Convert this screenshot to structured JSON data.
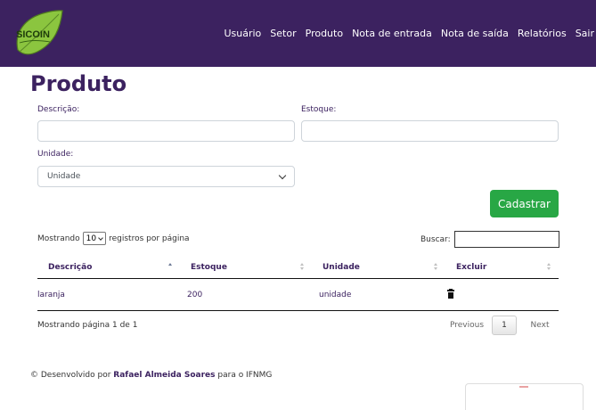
{
  "app": {
    "logo_text": "SICOIN"
  },
  "nav": [
    {
      "label": "Usuário"
    },
    {
      "label": "Setor"
    },
    {
      "label": "Produto"
    },
    {
      "label": "Nota de entrada"
    },
    {
      "label": "Nota de saída"
    },
    {
      "label": "Relatórios"
    },
    {
      "label": "Sair"
    }
  ],
  "page": {
    "title": "Produto"
  },
  "form": {
    "descricao_label": "Descrição:",
    "descricao_value": "",
    "estoque_label": "Estoque:",
    "estoque_value": "",
    "unidade_label": "Unidade:",
    "unidade_selected": "Unidade",
    "submit_label": "Cadastrar"
  },
  "table_controls": {
    "length_prefix": "Mostrando",
    "length_value": "10",
    "length_suffix": "registros por página",
    "search_label": "Buscar:",
    "search_value": ""
  },
  "table": {
    "columns": [
      "Descrição",
      "Estoque",
      "Unidade",
      "Excluir"
    ],
    "rows": [
      {
        "descricao": "laranja",
        "estoque": "200",
        "unidade": "unidade",
        "action_icon": "trash-icon"
      }
    ]
  },
  "pagination": {
    "info": "Mostrando página 1 de 1",
    "previous": "Previous",
    "current": "1",
    "next": "Next"
  },
  "footer": {
    "prefix": "© Desenvolvido por",
    "author": "Rafael Almeida Soares",
    "suffix": "para o IFNMG"
  },
  "colors": {
    "navbar": "#3c2260",
    "accent_text": "#3c2260",
    "success": "#28a745",
    "logo_leaf": "#8bc53f"
  }
}
